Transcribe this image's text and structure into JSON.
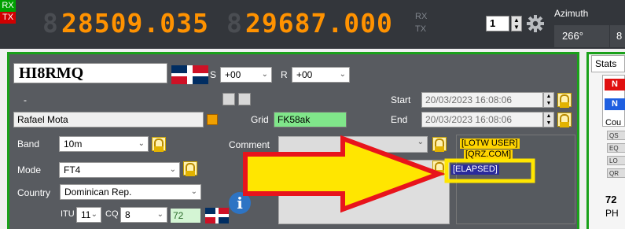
{
  "topbar": {
    "rx_tag": "RX",
    "tx_tag": "TX",
    "rx_frequency": "28509.035",
    "tx_frequency": "29687.000",
    "side_rx": "RX",
    "side_tx": "TX",
    "spin_value": "1",
    "azimuth_label": "Azimuth",
    "azimuth_value": "266°",
    "azimuth_value2": "8"
  },
  "qso": {
    "callsign": "HI8RMQ",
    "s_label": "S",
    "s_report": "+00",
    "r_label": "R",
    "r_report": "+00",
    "dash": "-",
    "name": "Rafael Mota",
    "grid_label": "Grid",
    "grid": "FK58ak",
    "start_label": "Start",
    "start_value": "20/03/2023 16:08:06",
    "end_label": "End",
    "end_value": "20/03/2023 16:08:06",
    "band_label": "Band",
    "band": "10m",
    "mode_label": "Mode",
    "mode": "FT4",
    "comment_label": "Comment",
    "country_label": "Country",
    "country": "Dominican Rep.",
    "itu_label": "ITU",
    "itu": "11",
    "cq_label": "CQ",
    "cq": "8",
    "dxcc_number": "72"
  },
  "tags": [
    "[LOTW USER]",
    "[QRZ.COM]",
    "[ELAPSED]"
  ],
  "stats": {
    "tab_label": "Stats",
    "chip_red": "N",
    "chip_blue": "N",
    "cou_label": "Cou",
    "btn1": "QS",
    "btn2": "EQ",
    "btn3": "LO",
    "btn4": "QR",
    "number": "72",
    "ph": "PH"
  },
  "colors": {
    "accent_green": "#1aa11a",
    "frequency_orange": "#ff9200",
    "highlight_yellow": "#ffe600",
    "arrow_red": "#e8141c"
  }
}
